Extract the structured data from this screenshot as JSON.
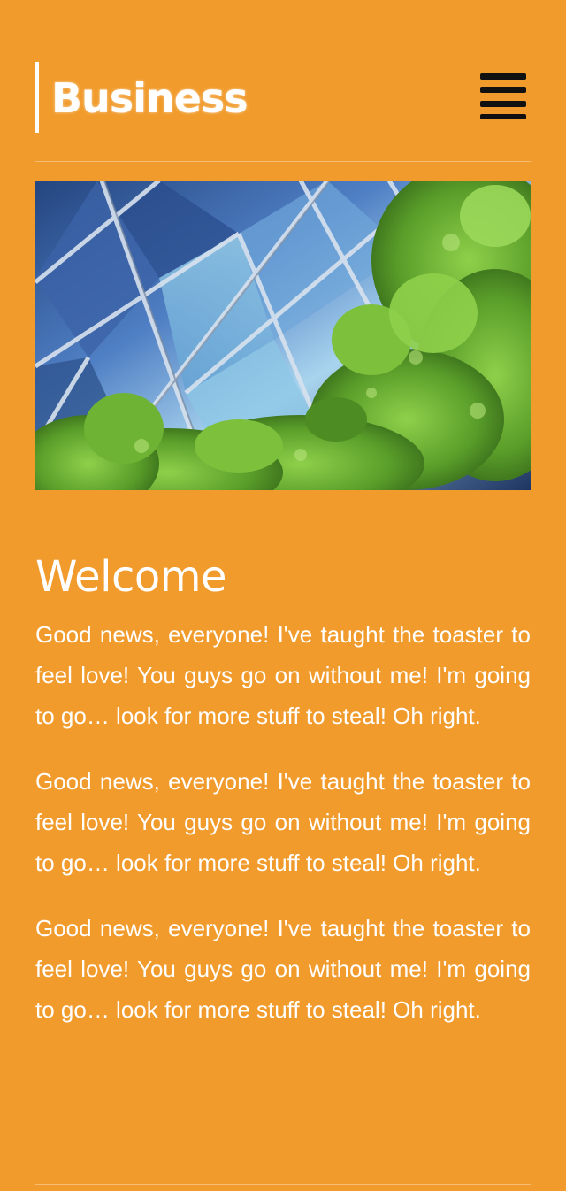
{
  "header": {
    "logo_text": "Business",
    "menu_icon": "hamburger-menu-icon"
  },
  "hero": {
    "alt": "Glass building facade with green trees"
  },
  "main": {
    "heading": "Welcome",
    "paragraphs": [
      "Good news, everyone! I've taught the toaster to feel love! You guys go on without me! I'm going to go… look for more stuff to steal! Oh right.",
      "Good news, everyone! I've taught the toaster to feel love! You guys go on without me! I'm going to go… look for more stuff to steal! Oh right.",
      "Good news, everyone! I've taught the toaster to feel love! You guys go on without me! I'm going to go… look for more stuff to steal! Oh right."
    ]
  },
  "colors": {
    "background": "#F19B2C",
    "text": "#FFFFFF",
    "menu_icon": "#111111"
  }
}
